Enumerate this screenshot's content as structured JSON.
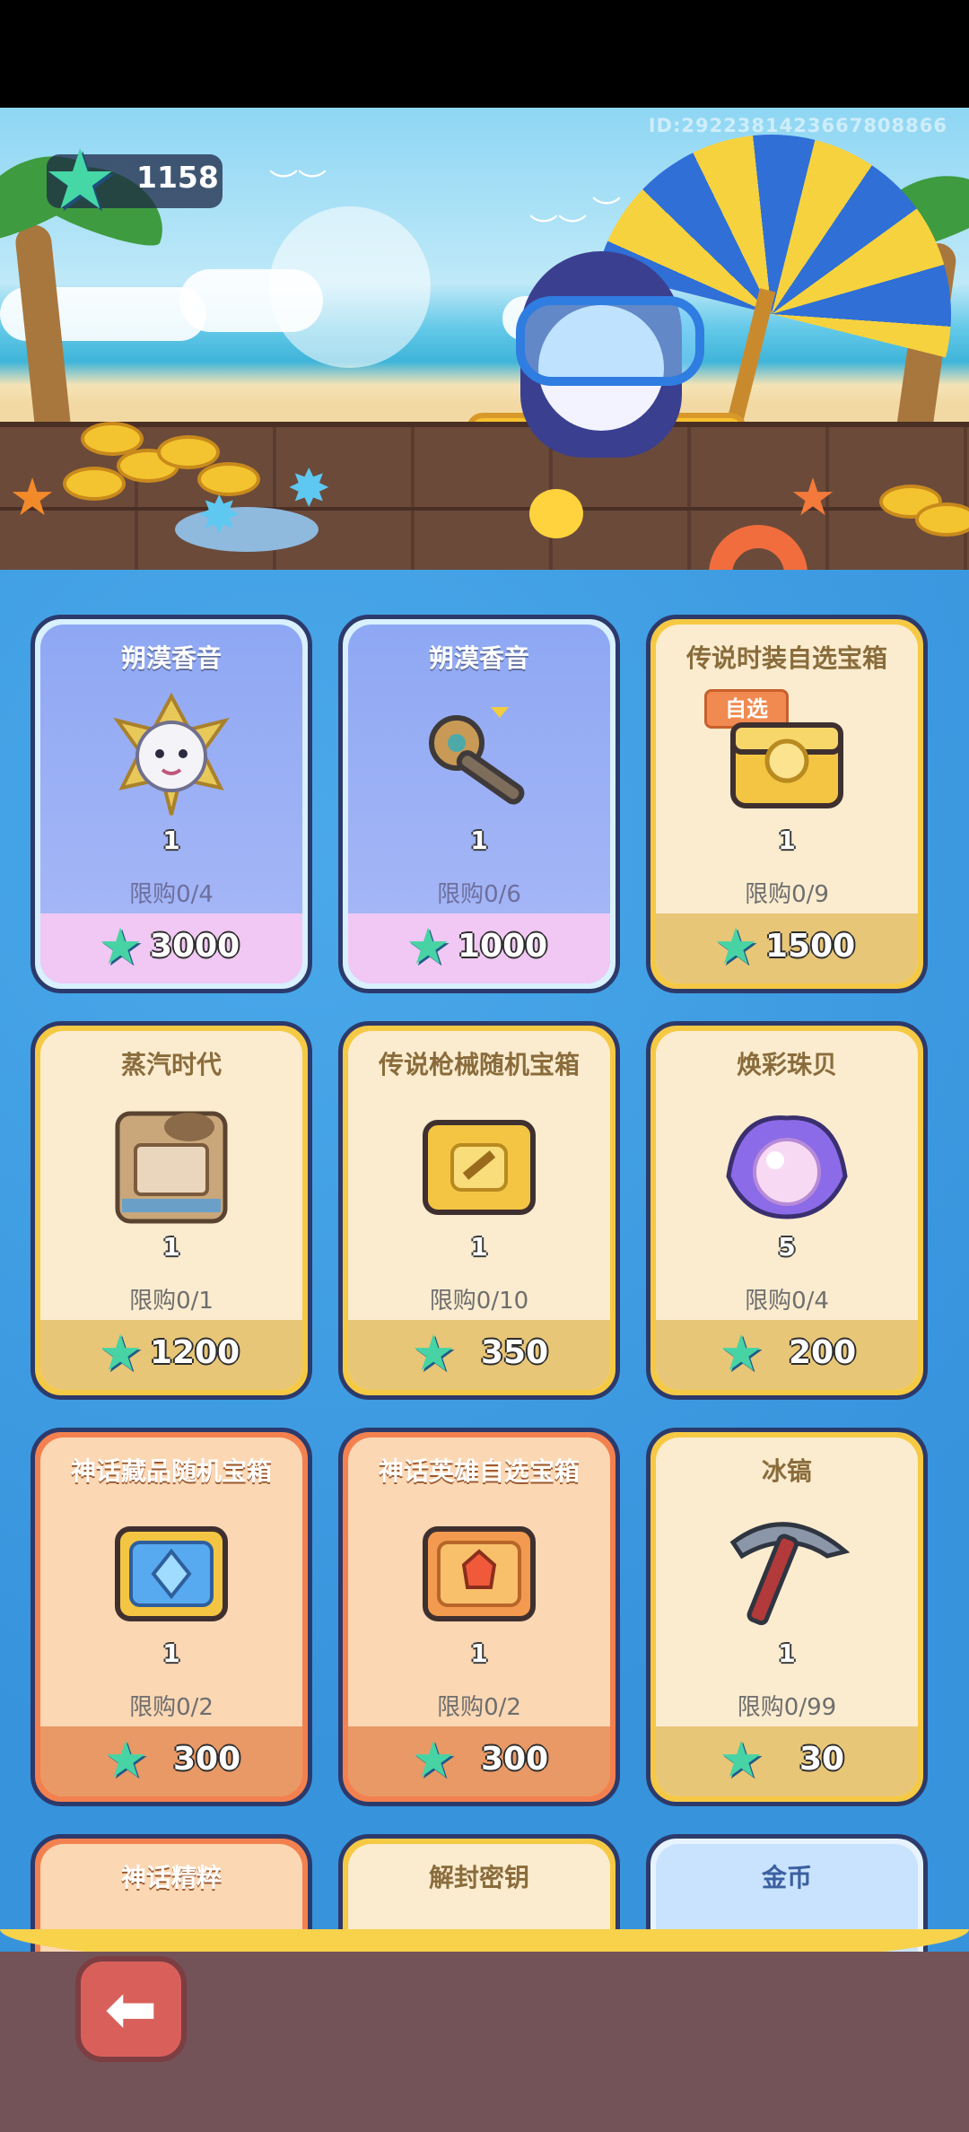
{
  "header": {
    "id_text": "ID:2922381423667808866",
    "currency_value": "1158"
  },
  "colors": {
    "shop_background": "#3793dc",
    "gem_star": "#48d3a5",
    "back_button": "#d9605a"
  },
  "items": [
    {
      "title": "朔漠香音",
      "qty": "1",
      "limit": "限购0/4",
      "price": "3000",
      "theme": "purple",
      "icon": "hero-skin-icon"
    },
    {
      "title": "朔漠香音",
      "qty": "1",
      "limit": "限购0/6",
      "price": "1000",
      "theme": "purple",
      "icon": "weapon-key-icon"
    },
    {
      "title": "传说时装自选宝箱",
      "tag": "自选",
      "qty": "1",
      "limit": "限购0/9",
      "price": "1500",
      "theme": "gold",
      "icon": "gold-chest-icon"
    },
    {
      "title": "蒸汽时代",
      "qty": "1",
      "limit": "限购0/1",
      "price": "1200",
      "theme": "gold",
      "icon": "steam-era-icon"
    },
    {
      "title": "传说枪械随机宝箱",
      "qty": "1",
      "limit": "限购0/10",
      "price": "350",
      "theme": "gold",
      "icon": "gun-chest-icon"
    },
    {
      "title": "焕彩珠贝",
      "qty": "5",
      "limit": "限购0/4",
      "price": "200",
      "theme": "gold",
      "icon": "pearl-shell-icon"
    },
    {
      "title": "神话藏品随机宝箱",
      "qty": "1",
      "limit": "限购0/2",
      "price": "300",
      "theme": "orange",
      "icon": "blue-chest-icon"
    },
    {
      "title": "神话英雄自选宝箱",
      "qty": "1",
      "limit": "限购0/2",
      "price": "300",
      "theme": "orange",
      "icon": "hero-chest-icon"
    },
    {
      "title": "冰镐",
      "qty": "1",
      "limit": "限购0/99",
      "price": "30",
      "theme": "gold",
      "icon": "ice-pick-icon"
    },
    {
      "title": "神话精粹",
      "theme": "orange"
    },
    {
      "title": "解封密钥",
      "theme": "gold"
    },
    {
      "title": "金币",
      "theme": "blue"
    }
  ]
}
